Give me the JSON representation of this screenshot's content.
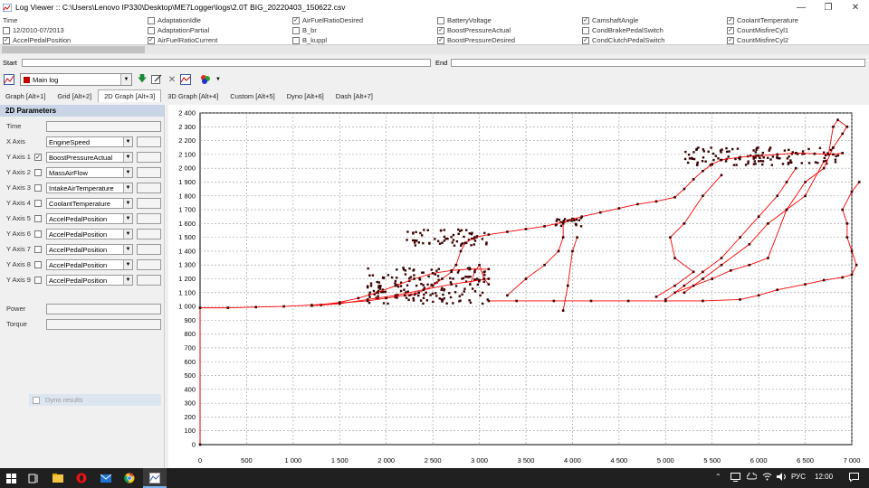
{
  "window": {
    "title": "Log Viewer :: C:\\Users\\Lenovo IP330\\Desktop\\ME7Logger\\logs\\2.0T BIG_20220403_150622.csv"
  },
  "channels": [
    {
      "label": "Time",
      "checkbox": false,
      "checked": false
    },
    {
      "label": "12/2010-07/2013",
      "checkbox": true,
      "checked": false
    },
    {
      "label": "AccelPedalPosition",
      "checkbox": true,
      "checked": true
    },
    {
      "label": "AdaptationIdle",
      "checkbox": true,
      "checked": false
    },
    {
      "label": "AdaptationPartial",
      "checkbox": true,
      "checked": false
    },
    {
      "label": "AirFuelRatioCurrent",
      "checkbox": true,
      "checked": true
    },
    {
      "label": "AirFuelRatioDesired",
      "checkbox": true,
      "checked": true
    },
    {
      "label": "B_br",
      "checkbox": true,
      "checked": false
    },
    {
      "label": "B_kuppl",
      "checkbox": true,
      "checked": false
    },
    {
      "label": "BatteryVoltage",
      "checkbox": true,
      "checked": false
    },
    {
      "label": "BoostPressureActual",
      "checkbox": true,
      "checked": true
    },
    {
      "label": "BoostPressureDesired",
      "checkbox": true,
      "checked": true
    },
    {
      "label": "CamshaftAngle",
      "checkbox": true,
      "checked": true
    },
    {
      "label": "CondBrakePedalSwitch",
      "checkbox": true,
      "checked": false
    },
    {
      "label": "CondClutchPedalSwitch",
      "checkbox": true,
      "checked": true
    },
    {
      "label": "CoolantTemperature",
      "checkbox": true,
      "checked": true
    },
    {
      "label": "CountMisfireCyl1",
      "checkbox": true,
      "checked": true
    },
    {
      "label": "CountMisfireCyl2",
      "checkbox": true,
      "checked": true
    }
  ],
  "range": {
    "start_label": "Start",
    "end_label": "End"
  },
  "toolbar": {
    "log_name": "Main log"
  },
  "tabs": [
    {
      "label": "Graph [Alt+1]",
      "active": false
    },
    {
      "label": "Grid [Alt+2]",
      "active": false
    },
    {
      "label": "2D Graph [Alt+3]",
      "active": true
    },
    {
      "label": "3D Graph [Alt+4]",
      "active": false
    },
    {
      "label": "Custom [Alt+5]",
      "active": false
    },
    {
      "label": "Dyno [Alt+6]",
      "active": false
    },
    {
      "label": "Dash [Alt+7]",
      "active": false
    }
  ],
  "params": {
    "header": "2D Parameters",
    "time_label": "Time",
    "x_axis": {
      "label": "X Axis",
      "value": "EngineSpeed"
    },
    "y_axes": [
      {
        "label": "Y Axis 1",
        "checked": true,
        "value": "BoostPressureActual"
      },
      {
        "label": "Y Axis 2",
        "checked": false,
        "value": "MassAirFlow"
      },
      {
        "label": "Y Axis 3",
        "checked": false,
        "value": "IntakeAirTemperature"
      },
      {
        "label": "Y Axis 4",
        "checked": false,
        "value": "CoolantTemperature"
      },
      {
        "label": "Y Axis 5",
        "checked": false,
        "value": "AccelPedalPosition"
      },
      {
        "label": "Y Axis 6",
        "checked": false,
        "value": "AccelPedalPosition"
      },
      {
        "label": "Y Axis 7",
        "checked": false,
        "value": "AccelPedalPosition"
      },
      {
        "label": "Y Axis 8",
        "checked": false,
        "value": "AccelPedalPosition"
      },
      {
        "label": "Y Axis 9",
        "checked": false,
        "value": "AccelPedalPosition"
      }
    ],
    "dyno_label": "Dyno results",
    "power_label": "Power",
    "torque_label": "Torque"
  },
  "taskbar": {
    "lang": "РУС",
    "time": "12:00",
    "icons": [
      "windows-start-icon",
      "task-view-icon",
      "file-explorer-icon",
      "opera-icon",
      "mail-icon",
      "chrome-icon",
      "logviewer-app-icon"
    ]
  },
  "chart_data": {
    "type": "scatter",
    "title": "",
    "xlabel": "",
    "ylabel": "",
    "xlim": [
      0,
      7000
    ],
    "ylim": [
      0,
      2400
    ],
    "x_ticks": [
      0,
      500,
      1000,
      1500,
      2000,
      2500,
      3000,
      3500,
      4000,
      4500,
      5000,
      5500,
      6000,
      6500,
      7000
    ],
    "x_tick_labels": [
      "0",
      "500",
      "1 000",
      "1 500",
      "2 000",
      "2 500",
      "3 000",
      "3 500",
      "4 000",
      "4 500",
      "5 000",
      "5 500",
      "6 000",
      "6 500",
      "7 000"
    ],
    "y_ticks": [
      0,
      100,
      200,
      300,
      400,
      500,
      600,
      700,
      800,
      900,
      1000,
      1100,
      1200,
      1300,
      1400,
      1500,
      1600,
      1700,
      1800,
      1900,
      2000,
      2100,
      2200,
      2300,
      2400
    ],
    "y_tick_labels": [
      "0",
      "100",
      "200",
      "300",
      "400",
      "500",
      "600",
      "700",
      "800",
      "900",
      "1 000",
      "1 100",
      "1 200",
      "1 300",
      "1 400",
      "1 500",
      "1 600",
      "1 700",
      "1 800",
      "1 900",
      "2 000",
      "2 100",
      "2 200",
      "2 300",
      "2 400"
    ],
    "grid": true,
    "colors": {
      "line": "#ff0000",
      "marker": "#3a0000"
    },
    "series": [
      {
        "points": [
          [
            0,
            0
          ],
          [
            0,
            990
          ],
          [
            300,
            990
          ],
          [
            600,
            995
          ],
          [
            900,
            1000
          ],
          [
            1200,
            1010
          ],
          [
            1500,
            1025
          ],
          [
            1800,
            1040
          ],
          [
            2000,
            1060
          ],
          [
            2200,
            1080
          ],
          [
            2350,
            1100
          ],
          [
            2500,
            1150
          ],
          [
            2600,
            1200
          ],
          [
            2700,
            1250
          ],
          [
            2750,
            1300
          ],
          [
            2800,
            1400
          ],
          [
            2850,
            1460
          ],
          [
            2950,
            1500
          ],
          [
            3100,
            1520
          ],
          [
            3300,
            1540
          ],
          [
            3500,
            1560
          ],
          [
            3700,
            1580
          ],
          [
            3900,
            1610
          ],
          [
            4100,
            1650
          ],
          [
            4300,
            1680
          ],
          [
            4500,
            1710
          ],
          [
            4700,
            1740
          ],
          [
            4900,
            1760
          ],
          [
            5100,
            1790
          ],
          [
            5200,
            1850
          ],
          [
            5300,
            1920
          ],
          [
            5400,
            1980
          ],
          [
            5500,
            2030
          ],
          [
            5600,
            2060
          ],
          [
            5800,
            2080
          ],
          [
            6000,
            2090
          ],
          [
            6200,
            2100
          ],
          [
            6400,
            2110
          ],
          [
            6600,
            2105
          ],
          [
            6800,
            2100
          ],
          [
            6900,
            2110
          ]
        ]
      },
      {
        "points": [
          [
            1300,
            1010
          ],
          [
            1500,
            1030
          ],
          [
            1700,
            1060
          ],
          [
            1900,
            1100
          ],
          [
            2100,
            1150
          ],
          [
            2300,
            1200
          ],
          [
            2500,
            1240
          ],
          [
            2700,
            1260
          ],
          [
            2900,
            1270
          ],
          [
            3100,
            1270
          ]
        ]
      },
      {
        "points": [
          [
            1200,
            1005
          ],
          [
            1500,
            1020
          ],
          [
            1800,
            1050
          ],
          [
            2100,
            1080
          ],
          [
            2400,
            1120
          ],
          [
            2700,
            1160
          ],
          [
            3000,
            1190
          ],
          [
            3100,
            1200
          ]
        ]
      },
      {
        "points": [
          [
            3100,
            1040
          ],
          [
            3400,
            1040
          ],
          [
            3800,
            1040
          ],
          [
            4200,
            1040
          ],
          [
            4600,
            1040
          ],
          [
            5000,
            1040
          ],
          [
            5400,
            1040
          ],
          [
            5800,
            1050
          ],
          [
            6000,
            1080
          ],
          [
            6200,
            1120
          ],
          [
            6500,
            1160
          ],
          [
            6700,
            1190
          ],
          [
            6900,
            1210
          ],
          [
            7000,
            1230
          ],
          [
            7050,
            1300
          ],
          [
            7000,
            1400
          ],
          [
            6950,
            1500
          ],
          [
            6950,
            1600
          ],
          [
            6900,
            1700
          ],
          [
            7000,
            1830
          ],
          [
            7080,
            1900
          ]
        ]
      },
      {
        "points": [
          [
            3300,
            1080
          ],
          [
            3500,
            1200
          ],
          [
            3700,
            1300
          ],
          [
            3850,
            1400
          ],
          [
            3900,
            1500
          ],
          [
            3900,
            1600
          ],
          [
            3950,
            1620
          ]
        ]
      },
      {
        "points": [
          [
            3900,
            970
          ],
          [
            3950,
            1150
          ],
          [
            4000,
            1400
          ],
          [
            4050,
            1500
          ]
        ]
      },
      {
        "points": [
          [
            5000,
            1050
          ],
          [
            5200,
            1150
          ],
          [
            5400,
            1250
          ],
          [
            5600,
            1350
          ],
          [
            5800,
            1500
          ],
          [
            6000,
            1650
          ],
          [
            6200,
            1800
          ],
          [
            6300,
            1900
          ],
          [
            6400,
            2000
          ]
        ]
      },
      {
        "points": [
          [
            5200,
            1100
          ],
          [
            5400,
            1200
          ],
          [
            5600,
            1300
          ],
          [
            5900,
            1450
          ],
          [
            6100,
            1600
          ],
          [
            6300,
            1700
          ],
          [
            6500,
            1900
          ],
          [
            6700,
            2000
          ],
          [
            6800,
            2150
          ],
          [
            6900,
            2250
          ],
          [
            6950,
            2300
          ],
          [
            6850,
            2350
          ],
          [
            6800,
            2300
          ],
          [
            6750,
            2100
          ]
        ]
      },
      {
        "points": [
          [
            5100,
            1100
          ],
          [
            5300,
            1150
          ],
          [
            5500,
            1200
          ],
          [
            5700,
            1260
          ],
          [
            5900,
            1300
          ],
          [
            6100,
            1350
          ],
          [
            6300,
            1700
          ],
          [
            6500,
            1800
          ],
          [
            6700,
            2050
          ]
        ]
      },
      {
        "points": [
          [
            4900,
            1070
          ],
          [
            5100,
            1150
          ],
          [
            5300,
            1250
          ],
          [
            5100,
            1350
          ],
          [
            5050,
            1500
          ],
          [
            5200,
            1600
          ],
          [
            5400,
            1800
          ],
          [
            5600,
            1950
          ]
        ]
      },
      {
        "points": [
          [
            2900,
            1160
          ],
          [
            2950,
            1250
          ],
          [
            3000,
            1300
          ],
          [
            3050,
            1200
          ],
          [
            3100,
            1160
          ]
        ]
      }
    ],
    "scatter_clusters": [
      {
        "x_range": [
          5200,
          6900
        ],
        "y_range": [
          2020,
          2150
        ],
        "count": 120
      },
      {
        "x_range": [
          1800,
          3100
        ],
        "y_range": [
          1020,
          1280
        ],
        "count": 160
      },
      {
        "x_range": [
          3800,
          4100
        ],
        "y_range": [
          1580,
          1640
        ],
        "count": 20
      },
      {
        "x_range": [
          2200,
          3100
        ],
        "y_range": [
          1440,
          1560
        ],
        "count": 60
      }
    ]
  }
}
